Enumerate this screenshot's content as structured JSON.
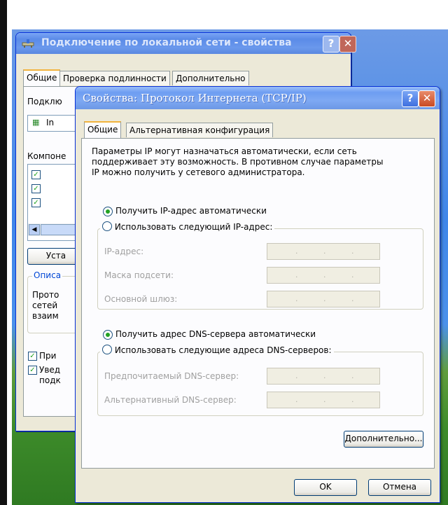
{
  "back_window": {
    "title": "Подключение по локальной сети - свойства",
    "help_glyph": "?",
    "close_glyph": "✕",
    "tabs": [
      "Общие",
      "Проверка подлинности",
      "Дополнительно"
    ],
    "connect_label": "Подклю",
    "adapter_text": "In",
    "components_label": "Компоне",
    "install_button": "Уста",
    "description_group": "Описа",
    "description_lines": [
      "Прото",
      "сетей",
      "взаим"
    ],
    "show_icon_checkbox": "При",
    "notify_checkbox_lines": [
      "Увед",
      "подк"
    ]
  },
  "front_window": {
    "title": "Свойства: Протокол Интернета (TCP/IP)",
    "help_glyph": "?",
    "close_glyph": "✕",
    "tabs": [
      "Общие",
      "Альтернативная конфигурация"
    ],
    "intro_lines": [
      "Параметры IP могут назначаться автоматически, если сеть",
      "поддерживает эту возможность. В противном случае параметры",
      "IP можно получить у сетевого администратора."
    ],
    "ip_auto": "Получить IP-адрес автоматически",
    "ip_manual": "Использовать следующий IP-адрес:",
    "ip_fields": [
      "IP-адрес:",
      "Маска подсети:",
      "Основной шлюз:"
    ],
    "dns_auto": "Получить адрес DNS-сервера автоматически",
    "dns_manual": "Использовать следующие адреса DNS-серверов:",
    "dns_fields": [
      "Предпочитаемый DNS-сервер:",
      "Альтернативный DNS-сервер:"
    ],
    "ip_dot": ".",
    "advanced_button": "Дополнительно...",
    "ok_button": "OK",
    "cancel_button": "Отмена"
  },
  "colors": {
    "xp_blue_title": "#6d9df2",
    "xp_window_bg": "#ece9d8",
    "radio_selected": "#23a223"
  }
}
